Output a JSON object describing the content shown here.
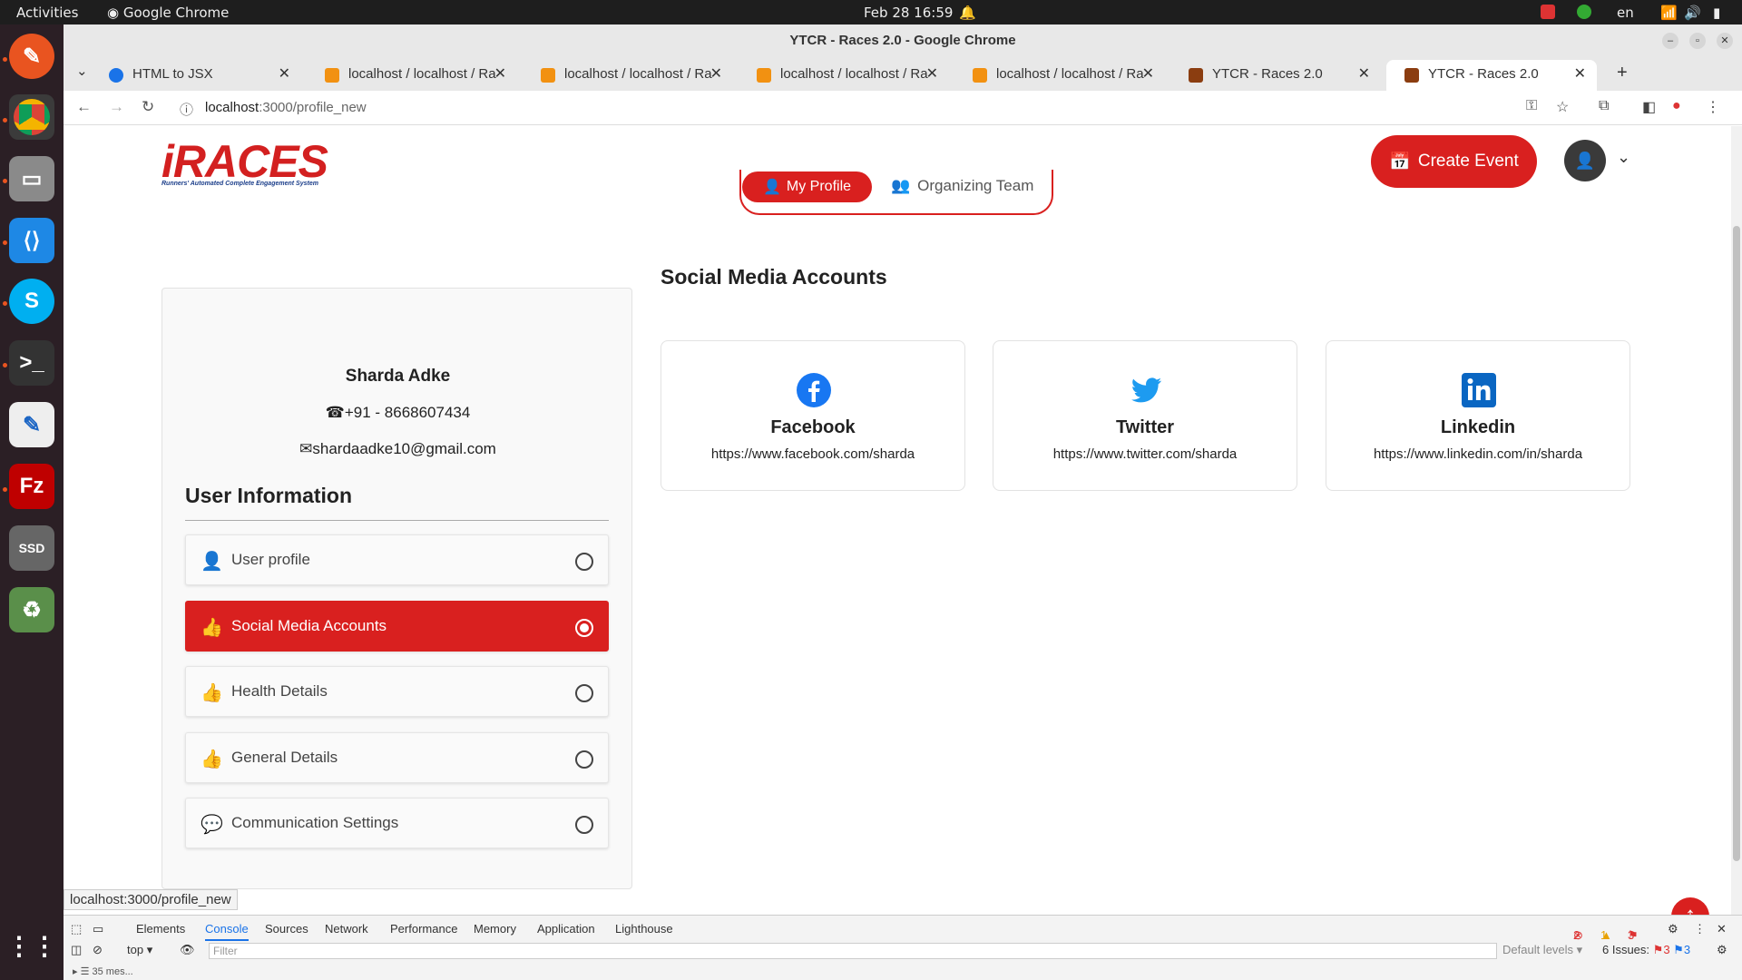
{
  "os": {
    "activities": "Activities",
    "app": "Google Chrome",
    "clock": "Feb 28  16:59",
    "lang": "en"
  },
  "window": {
    "title": "YTCR - Races 2.0 - Google Chrome"
  },
  "tabs": [
    {
      "label": "HTML to JSX"
    },
    {
      "label": "localhost / localhost / Ra"
    },
    {
      "label": "localhost / localhost / Ra"
    },
    {
      "label": "localhost / localhost / Ra"
    },
    {
      "label": "localhost / localhost / Ra"
    },
    {
      "label": "YTCR - Races 2.0"
    },
    {
      "label": "YTCR - Races 2.0"
    }
  ],
  "address": {
    "host": "localhost",
    "path": ":3000/profile_new"
  },
  "header": {
    "logo": "iRACES",
    "logo_tag": "Runners' Automated Complete Engagement System",
    "create_event": "Create Event",
    "avatar": "👤"
  },
  "switcher": {
    "profile": "My Profile",
    "team": "Organizing Team"
  },
  "user": {
    "name": "Sharda Adke",
    "phone": "+91 - 8668607434",
    "email": "shardaadke10@gmail.com"
  },
  "sidebar": {
    "heading": "User Information",
    "items": [
      {
        "label": "User profile"
      },
      {
        "label": "Social Media Accounts"
      },
      {
        "label": "Health Details"
      },
      {
        "label": "General Details"
      },
      {
        "label": "Communication Settings"
      }
    ]
  },
  "social": {
    "title": "Social Media Accounts",
    "accounts": [
      {
        "name": "Facebook",
        "url": "https://www.facebook.com/sharda",
        "color": "#1877f2"
      },
      {
        "name": "Twitter",
        "url": "https://www.twitter.com/sharda",
        "color": "#1d9bf0"
      },
      {
        "name": "Linkedin",
        "url": "https://www.linkedin.com/in/sharda",
        "color": "#0a66c2"
      }
    ]
  },
  "status_url": "localhost:3000/profile_new",
  "devtools": {
    "tabs": [
      "Elements",
      "Console",
      "Sources",
      "Network",
      "Performance",
      "Memory",
      "Application",
      "Lighthouse"
    ],
    "context": "top",
    "filter_placeholder": "Filter",
    "levels": "Default levels",
    "issues": "6 Issues:",
    "messages": "35 mes...",
    "errors": "2",
    "warnings": "1",
    "flags": "3",
    "issue_err": "3",
    "issue_info": "3"
  },
  "colors": {
    "brand": "#d9201f"
  }
}
